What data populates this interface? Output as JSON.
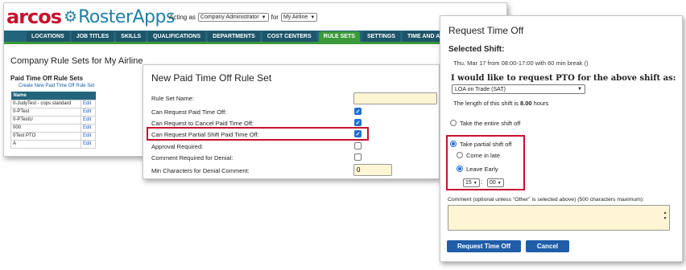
{
  "main": {
    "logo_arcos": "arcos",
    "logo_roster": "RosterApps",
    "acting_label": "Acting as",
    "acting_value": "Company Administrator",
    "for_label": "for",
    "for_value": "My Airline",
    "tabs": [
      "LOCATIONS",
      "JOB TITLES",
      "SKILLS",
      "QUALIFICATIONS",
      "DEPARTMENTS",
      "COST CENTERS",
      "RULE SETS",
      "SETTINGS",
      "TIME AND ATTENDANCE SETTINGS"
    ],
    "active_tab": "RULE SETS",
    "page_title": "Company Rule Sets for My Airline",
    "section_title": "Paid Time Off Rule Sets",
    "create_link": "Create New Paid Time Off Rule Set",
    "table_header": "Name",
    "rows": [
      {
        "name": "0-JudyTest - cops standard",
        "action": "Edit"
      },
      {
        "name": "0-PTest",
        "action": "Edit"
      },
      {
        "name": "0-PTestU",
        "action": "Edit"
      },
      {
        "name": "000",
        "action": "Edit"
      },
      {
        "name": "0Test PTO",
        "action": "Edit"
      },
      {
        "name": "A",
        "action": "Edit"
      }
    ]
  },
  "mid": {
    "title": "New Paid Time Off Rule Set",
    "fields": [
      {
        "label": "Rule Set Name:",
        "type": "text",
        "value": ""
      },
      {
        "label": "Can Request Paid Time Off:",
        "type": "checkbox",
        "checked": true
      },
      {
        "label": "Can Request to Cancel Paid Time Off:",
        "type": "checkbox",
        "checked": true
      },
      {
        "label": "Can Request Partial Shift Paid Time Off:",
        "type": "checkbox",
        "checked": true
      },
      {
        "label": "Approval Required:",
        "type": "checkbox",
        "checked": false
      },
      {
        "label": "Comment Required for Denial:",
        "type": "checkbox",
        "checked": false
      },
      {
        "label": "Min Characters for Denial Comment:",
        "type": "text",
        "value": "0"
      }
    ]
  },
  "right": {
    "title": "Request Time Off",
    "selected_shift_label": "Selected Shift:",
    "shift_text": "Thu, Mar 17 from 08:00-17:00 with 60 min break ()",
    "request_label": "I would like to request PTO for the above shift as:",
    "pto_type": "LOA on Trade (SAT)",
    "length_prefix": "The length of this shift is ",
    "length_value": "8.00",
    "length_suffix": " hours",
    "opt_entire": "Take the entire shift off",
    "opt_partial": "Take partial shift off",
    "opt_come_late": "Come in late",
    "opt_leave_early": "Leave Early",
    "hour": "15",
    "minute": "00",
    "comment_label": "Comment (optional unless \"Other\" is selected above) (500 characters maximum):",
    "comment_value": "",
    "submit_label": "Request Time Off",
    "cancel_label": "Cancel"
  },
  "colors": {
    "brand_red": "#c8102e",
    "brand_teal": "#23647d",
    "active_tab_green": "#3a9a3a",
    "button_blue": "#1f5da8",
    "input_yellow": "#fdf5d3",
    "highlight_red": "#c8102e"
  }
}
